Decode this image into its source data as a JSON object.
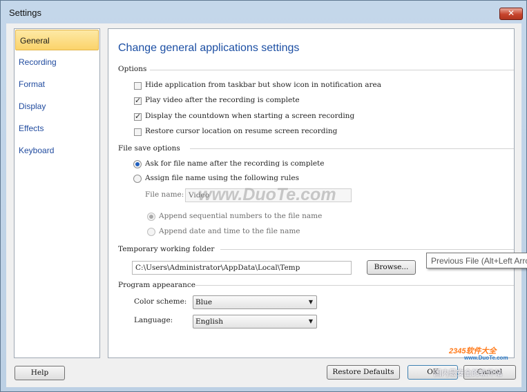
{
  "window": {
    "title": "Settings",
    "close_glyph": "✕"
  },
  "nav": {
    "items": [
      "General",
      "Recording",
      "Format",
      "Display",
      "Effects",
      "Keyboard"
    ],
    "selected": "General"
  },
  "main": {
    "heading": "Change general applications settings",
    "options": {
      "title": "Options",
      "items": [
        {
          "label": "Hide application from taskbar but show icon in notification area",
          "checked": false
        },
        {
          "label": "Play video after the recording is complete",
          "checked": true
        },
        {
          "label": "Display the countdown when starting a screen recording",
          "checked": true
        },
        {
          "label": "Restore cursor location on resume screen recording",
          "checked": false
        }
      ]
    },
    "file_save": {
      "title": "File save options",
      "ask_label": "Ask for file name after the recording is complete",
      "assign_label": "Assign file name using the following rules",
      "file_name_label": "File name:",
      "file_name_value": "Video",
      "append_seq_label": "Append sequential numbers to the file name",
      "append_date_label": "Append date and time to the file name"
    },
    "temp_folder": {
      "title": "Temporary working folder",
      "path": "C:\\Users\\Administrator\\AppData\\Local\\Temp",
      "browse_label": "Browse..."
    },
    "appearance": {
      "title": "Program appearance",
      "color_scheme_label": "Color scheme:",
      "color_scheme_value": "Blue",
      "language_label": "Language:",
      "language_value": "English"
    }
  },
  "footer": {
    "help_label": "Help",
    "restore_label": "Restore Defaults",
    "ok_label": "OK",
    "cancel_label": "Cancel"
  },
  "tooltip": {
    "text": "Previous File (Alt+Left Arrow)"
  },
  "watermarks": {
    "center": "www.DuoTe.com",
    "corner_brand": "2345软件大全",
    "corner_url": "www.DuoTe.com",
    "corner_site": "国内最安全的软件站"
  },
  "colors": {
    "accent": "#1b4ea3",
    "nav_selected": "#fbd36a",
    "close_button": "#c7442d"
  }
}
